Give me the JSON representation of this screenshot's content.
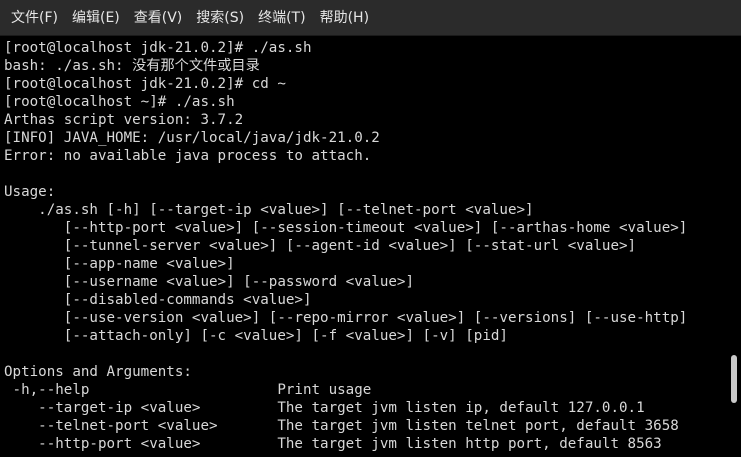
{
  "menu": [
    {
      "label": "文件(F)"
    },
    {
      "label": "编辑(E)"
    },
    {
      "label": "查看(V)"
    },
    {
      "label": "搜索(S)"
    },
    {
      "label": "终端(T)"
    },
    {
      "label": "帮助(H)"
    }
  ],
  "terminal": {
    "lines": [
      "[root@localhost jdk-21.0.2]# ./as.sh",
      "bash: ./as.sh: 没有那个文件或目录",
      "[root@localhost jdk-21.0.2]# cd ~",
      "[root@localhost ~]# ./as.sh",
      "Arthas script version: 3.7.2",
      "[INFO] JAVA_HOME: /usr/local/java/jdk-21.0.2",
      "Error: no available java process to attach.",
      "",
      "Usage:",
      "    ./as.sh [-h] [--target-ip <value>] [--telnet-port <value>]",
      "       [--http-port <value>] [--session-timeout <value>] [--arthas-home <value>]",
      "       [--tunnel-server <value>] [--agent-id <value>] [--stat-url <value>]",
      "       [--app-name <value>]",
      "       [--username <value>] [--password <value>]",
      "       [--disabled-commands <value>]",
      "       [--use-version <value>] [--repo-mirror <value>] [--versions] [--use-http]",
      "       [--attach-only] [-c <value>] [-f <value>] [-v] [pid]",
      "",
      "Options and Arguments:",
      " -h,--help                      Print usage",
      "    --target-ip <value>         The target jvm listen ip, default 127.0.0.1",
      "    --telnet-port <value>       The target jvm listen telnet port, default 3658",
      "    --http-port <value>         The target jvm listen http port, default 8563"
    ]
  },
  "colors": {
    "menubar_bg": "#2b2b2b",
    "menu_text": "#e6e6e6",
    "terminal_bg": "#000000",
    "terminal_text": "#d8d8d8",
    "scroll_thumb": "#c9c9c9"
  }
}
